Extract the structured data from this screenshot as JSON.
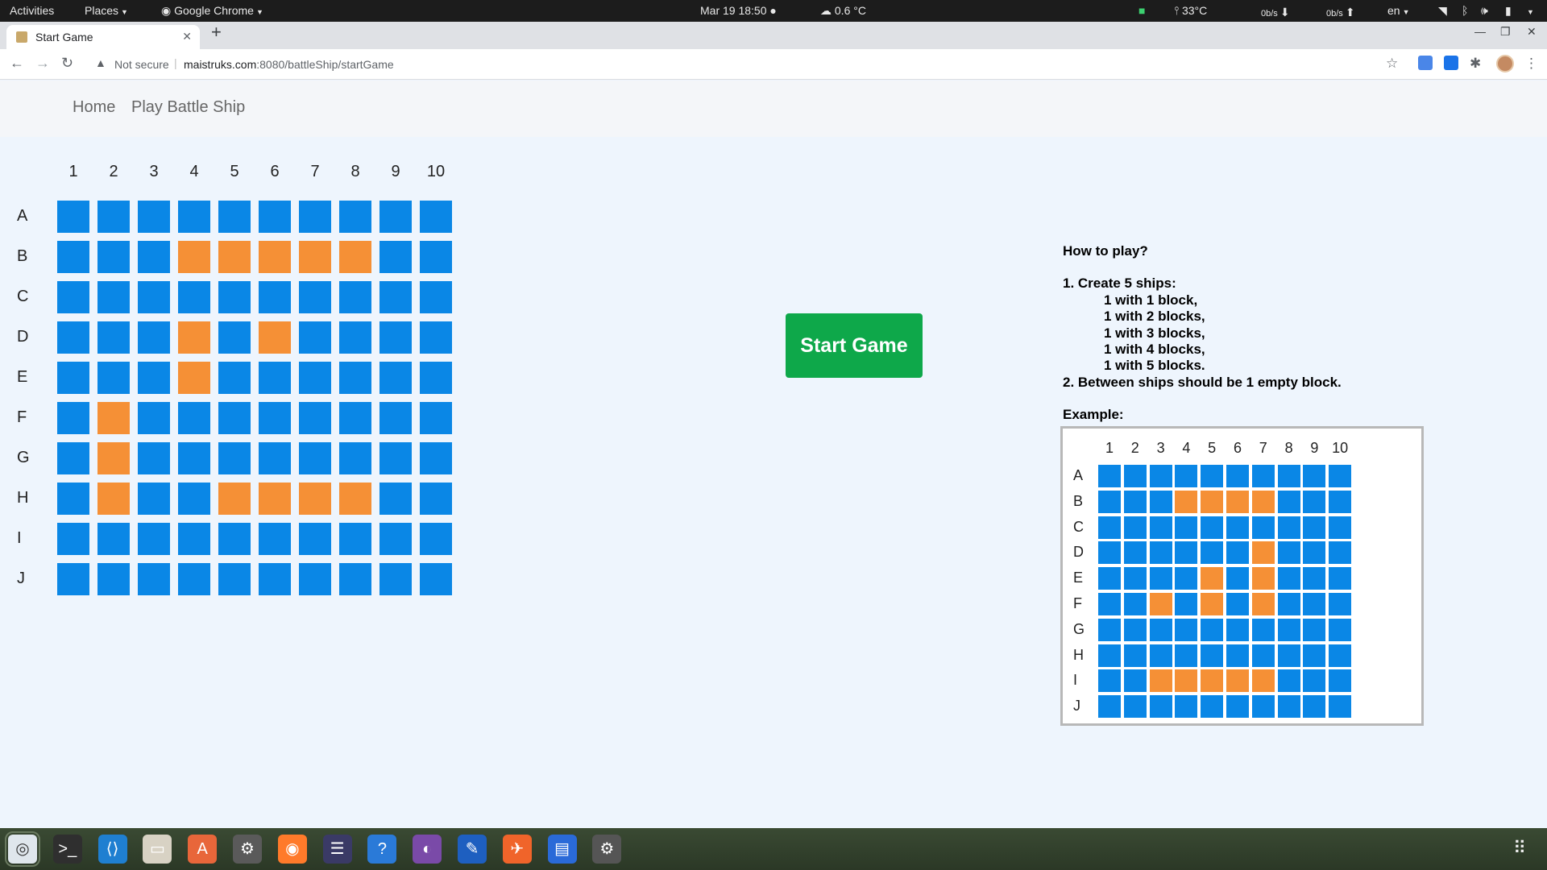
{
  "system": {
    "activities": "Activities",
    "places": "Places",
    "app": "Google Chrome",
    "datetime": "Mar 19  18:50",
    "weather": "0.6 °C",
    "cpu_temp": "33°C",
    "net_down": "0b/s",
    "net_up": "0b/s",
    "lang": "en"
  },
  "browser": {
    "tab_title": "Start Game",
    "not_secure": "Not secure",
    "url_host": "maistruks.com",
    "url_path": ":8080/battleShip/startGame"
  },
  "nav": {
    "home": "Home",
    "play": "Play Battle Ship"
  },
  "board": {
    "columns": [
      "1",
      "2",
      "3",
      "4",
      "5",
      "6",
      "7",
      "8",
      "9",
      "10"
    ],
    "rows": [
      "A",
      "B",
      "C",
      "D",
      "E",
      "F",
      "G",
      "H",
      "I",
      "J"
    ],
    "ships": [
      [
        0,
        0,
        0,
        0,
        0,
        0,
        0,
        0,
        0,
        0
      ],
      [
        0,
        0,
        0,
        1,
        1,
        1,
        1,
        1,
        0,
        0
      ],
      [
        0,
        0,
        0,
        0,
        0,
        0,
        0,
        0,
        0,
        0
      ],
      [
        0,
        0,
        0,
        1,
        0,
        1,
        0,
        0,
        0,
        0
      ],
      [
        0,
        0,
        0,
        1,
        0,
        0,
        0,
        0,
        0,
        0
      ],
      [
        0,
        1,
        0,
        0,
        0,
        0,
        0,
        0,
        0,
        0
      ],
      [
        0,
        1,
        0,
        0,
        0,
        0,
        0,
        0,
        0,
        0
      ],
      [
        0,
        1,
        0,
        0,
        1,
        1,
        1,
        1,
        0,
        0
      ],
      [
        0,
        0,
        0,
        0,
        0,
        0,
        0,
        0,
        0,
        0
      ],
      [
        0,
        0,
        0,
        0,
        0,
        0,
        0,
        0,
        0,
        0
      ]
    ]
  },
  "start_button": "Start Game",
  "howto": {
    "title": "How to play?",
    "step1": "1. Create 5 ships:",
    "ships": [
      "1 with 1 block,",
      "1 with 2 blocks,",
      "1 with 3 blocks,",
      "1 with 4 blocks,",
      "1 with 5 blocks."
    ],
    "step2": "2. Between ships should be 1 empty block.",
    "example_label": "Example:"
  },
  "example": {
    "ships": [
      [
        0,
        0,
        0,
        0,
        0,
        0,
        0,
        0,
        0,
        0
      ],
      [
        0,
        0,
        0,
        1,
        1,
        1,
        1,
        0,
        0,
        0
      ],
      [
        0,
        0,
        0,
        0,
        0,
        0,
        0,
        0,
        0,
        0
      ],
      [
        0,
        0,
        0,
        0,
        0,
        0,
        1,
        0,
        0,
        0
      ],
      [
        0,
        0,
        0,
        0,
        1,
        0,
        1,
        0,
        0,
        0
      ],
      [
        0,
        0,
        1,
        0,
        1,
        0,
        1,
        0,
        0,
        0
      ],
      [
        0,
        0,
        0,
        0,
        0,
        0,
        0,
        0,
        0,
        0
      ],
      [
        0,
        0,
        0,
        0,
        0,
        0,
        0,
        0,
        0,
        0
      ],
      [
        0,
        0,
        1,
        1,
        1,
        1,
        1,
        0,
        0,
        0
      ],
      [
        0,
        0,
        0,
        0,
        0,
        0,
        0,
        0,
        0,
        0
      ]
    ]
  },
  "colors": {
    "water": "#0a87e6",
    "ship": "#f59036",
    "start": "#0ea84a"
  },
  "dock_icons": [
    "chrome-icon",
    "terminal-icon",
    "vscode-icon",
    "files-icon",
    "software-icon",
    "settings-icon",
    "firefox-icon",
    "eclipse-icon",
    "help-icon",
    "toggle-app-icon",
    "text-editor-icon",
    "postman-icon",
    "docs-icon",
    "settings-gear-icon"
  ]
}
